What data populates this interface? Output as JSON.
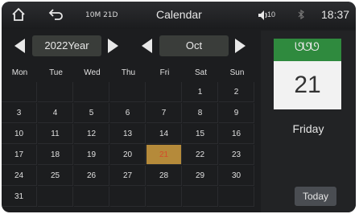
{
  "status_bar": {
    "date_short": "10M 21D",
    "title": "Calendar",
    "volume": "10",
    "clock": "18:37",
    "icons": [
      "home-icon",
      "back-icon",
      "volume-icon",
      "bluetooth-icon"
    ]
  },
  "navigation": {
    "year": "2022Year",
    "month": "Oct"
  },
  "weekdays": [
    "Mon",
    "Tue",
    "Wed",
    "Thu",
    "Fri",
    "Sat",
    "Sun"
  ],
  "calendar": {
    "rows": [
      [
        "",
        "",
        "",
        "",
        "",
        "1",
        "2"
      ],
      [
        "3",
        "4",
        "5",
        "6",
        "7",
        "8",
        "9"
      ],
      [
        "10",
        "11",
        "12",
        "13",
        "14",
        "15",
        "16"
      ],
      [
        "17",
        "18",
        "19",
        "20",
        "21",
        "22",
        "23"
      ],
      [
        "24",
        "25",
        "26",
        "27",
        "28",
        "29",
        "30"
      ],
      [
        "31",
        "",
        "",
        "",
        "",
        "",
        ""
      ]
    ],
    "selected_day": "21"
  },
  "side_panel": {
    "day_number": "21",
    "weekday": "Friday",
    "today_button": "Today"
  },
  "colors": {
    "background": "#1c1d1f",
    "highlight": "#b58a3a",
    "card_header": "#2f8a3e"
  }
}
